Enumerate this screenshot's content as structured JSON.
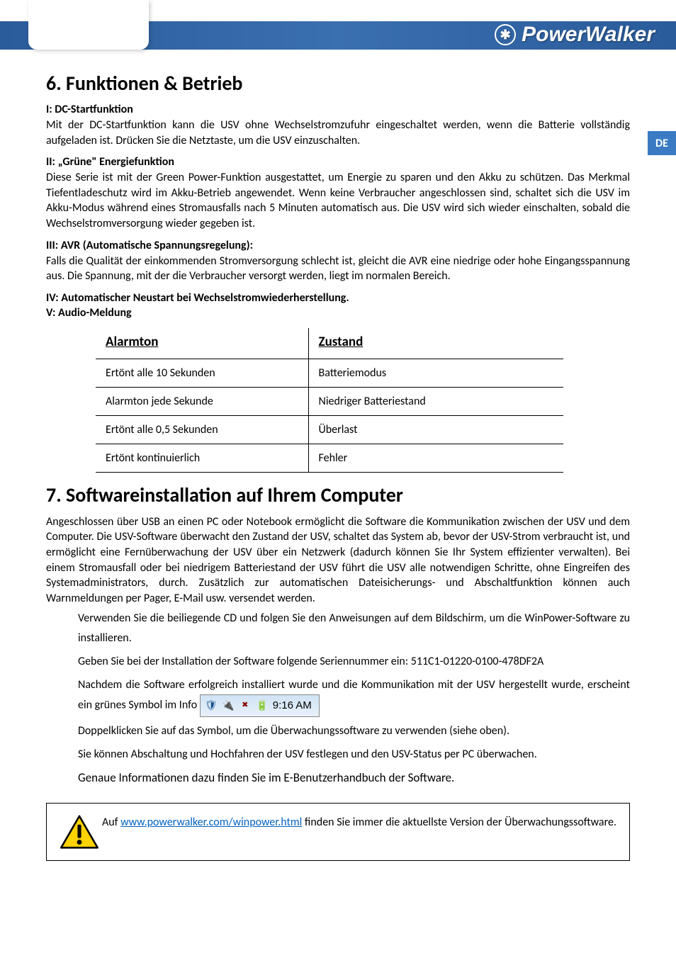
{
  "brand": "PowerWalker",
  "lang_tab": "DE",
  "section6": {
    "title": "6. Funktionen & Betrieb",
    "i_head": "I: DC-Startfunktion",
    "i_body": "Mit der DC-Startfunktion kann die USV ohne Wechselstromzufuhr eingeschaltet werden, wenn die Batterie vollständig aufgeladen ist. Drücken Sie die Netztaste, um die USV einzuschalten.",
    "ii_head": "II:  „Grüne\" Energiefunktion",
    "ii_body": "Diese Serie ist mit der Green Power-Funktion ausgestattet, um Energie zu sparen und den Akku zu schützen. Das Merkmal Tiefentladeschutz wird im Akku-Betrieb angewendet. Wenn keine Verbraucher angeschlossen sind, schaltet sich die USV im Akku-Modus während eines Stromausfalls nach 5 Minuten automatisch aus. Die USV wird sich wieder einschalten, sobald die Wechselstromversorgung wieder gegeben ist.",
    "iii_head": "III: AVR (Automatische Spannungsregelung):",
    "iii_body": "Falls die Qualität der einkommenden Stromversorgung schlecht ist, gleicht die AVR eine niedrige oder hohe Eingangsspannung aus. Die Spannung, mit der die Verbraucher versorgt werden, liegt im normalen Bereich.",
    "iv_head": "IV: Automatischer Neustart bei Wechselstromwiederherstellung.",
    "v_head": "V: Audio-Meldung"
  },
  "alarm_table": {
    "col1": "Alarmton",
    "col2": "Zustand",
    "rows": [
      {
        "a": "Ertönt alle 10 Sekunden",
        "b": "Batteriemodus"
      },
      {
        "a": "Alarmton jede Sekunde",
        "b": "Niedriger Batteriestand"
      },
      {
        "a": "Ertönt alle 0,5 Sekunden",
        "b": "Überlast"
      },
      {
        "a": "Ertönt kontinuierlich",
        "b": "Fehler"
      }
    ]
  },
  "section7": {
    "title": "7. Softwareinstallation auf Ihrem Computer",
    "intro": "Angeschlossen über USB an einen PC oder Notebook ermöglicht die Software die Kommunikation zwischen der USV und dem Computer. Die USV-Software überwacht den Zustand der USV, schaltet das System ab, bevor der USV-Strom verbraucht ist, und ermöglicht eine Fernüberwachung der USV über ein Netzwerk (dadurch können Sie Ihr System effizienter verwalten). Bei einem Stromausfall oder bei niedrigem Batteriestand der USV führt die USV alle notwendigen Schritte, ohne Eingreifen des Systemadministrators, durch. Zusätzlich zur automatischen Dateisicherungs- und Abschaltfunktion können auch Warnmeldungen per Pager, E-Mail usw. versendet werden.",
    "step1": "Verwenden Sie die beiliegende CD und folgen Sie den Anweisungen auf dem Bildschirm, um die WinPower-Software zu installieren.",
    "step2": "Geben Sie bei der Installation der Software folgende Seriennummer ein: 511C1-01220-0100-478DF2A",
    "step3_pre": "Nachdem die Software erfolgreich installiert wurde und die Kommunikation mit der USV hergestellt wurde, erscheint ein grünes Symbol im Info",
    "tray_time": "9:16 AM",
    "step4": "Doppelklicken Sie auf das Symbol, um die Überwachungssoftware zu verwenden (siehe oben).",
    "step5": "Sie können Abschaltung und Hochfahren der USV festlegen und den USV-Status per PC überwachen.",
    "step6": "Genaue Informationen dazu finden Sie im E-Benutzerhandbuch der Software."
  },
  "notice": {
    "pre": "Auf ",
    "link_text": "www.powerwalker.com/winpower.html",
    "post": " finden Sie immer die aktuellste Version der Überwachungssoftware."
  }
}
